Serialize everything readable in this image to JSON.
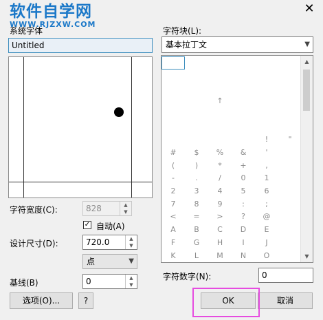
{
  "watermark": {
    "cn": "软件自学网",
    "url": "WWW.RJZXW.COM"
  },
  "window": {
    "close_glyph": "✕"
  },
  "left": {
    "system_label": "系统字体",
    "font_name": "Untitled",
    "char_width_label": "字符宽度(C):",
    "char_width_value": "828",
    "auto_label": "自动(A)",
    "auto_checked": true,
    "design_size_label": "设计尺寸(D):",
    "design_size_value": "720.0",
    "unit_value": "点",
    "baseline_label": "基线(B)",
    "baseline_value": "0",
    "options_button": "选项(O)...",
    "help_button": "?"
  },
  "right": {
    "char_block_label": "字符块(L):",
    "char_block_value": "基本拉丁文",
    "char_number_label": "字符数字(N):",
    "char_number_value": "0",
    "grid_rows": [
      [
        "",
        "",
        "",
        "",
        "",
        ""
      ],
      [
        "",
        "",
        "",
        "",
        "",
        ""
      ],
      [
        "",
        "",
        "",
        "",
        "",
        ""
      ],
      [
        "",
        "",
        "↑",
        "",
        "",
        ""
      ],
      [
        "",
        "",
        "",
        "",
        "",
        ""
      ],
      [
        "",
        "",
        "",
        "",
        "",
        ""
      ],
      [
        "",
        "",
        "",
        "",
        "!",
        "\""
      ],
      [
        "#",
        "$",
        "%",
        "&",
        "'",
        ""
      ],
      [
        "(",
        ")",
        "*",
        "+",
        ",",
        ""
      ],
      [
        "-",
        ".",
        "/",
        "0",
        "1",
        ""
      ],
      [
        "2",
        "3",
        "4",
        "5",
        "6",
        ""
      ],
      [
        "7",
        "8",
        "9",
        ":",
        ";",
        ""
      ],
      [
        "<",
        "=",
        ">",
        "?",
        "@",
        ""
      ],
      [
        "A",
        "B",
        "C",
        "D",
        "E",
        ""
      ],
      [
        "F",
        "G",
        "H",
        "I",
        "J",
        ""
      ],
      [
        "K",
        "L",
        "M",
        "N",
        "O",
        ""
      ]
    ]
  },
  "footer": {
    "ok_button": "OK",
    "cancel_button": "取消"
  },
  "colors": {
    "highlight": "#e64ce0",
    "watermark": "#1b78c8"
  }
}
